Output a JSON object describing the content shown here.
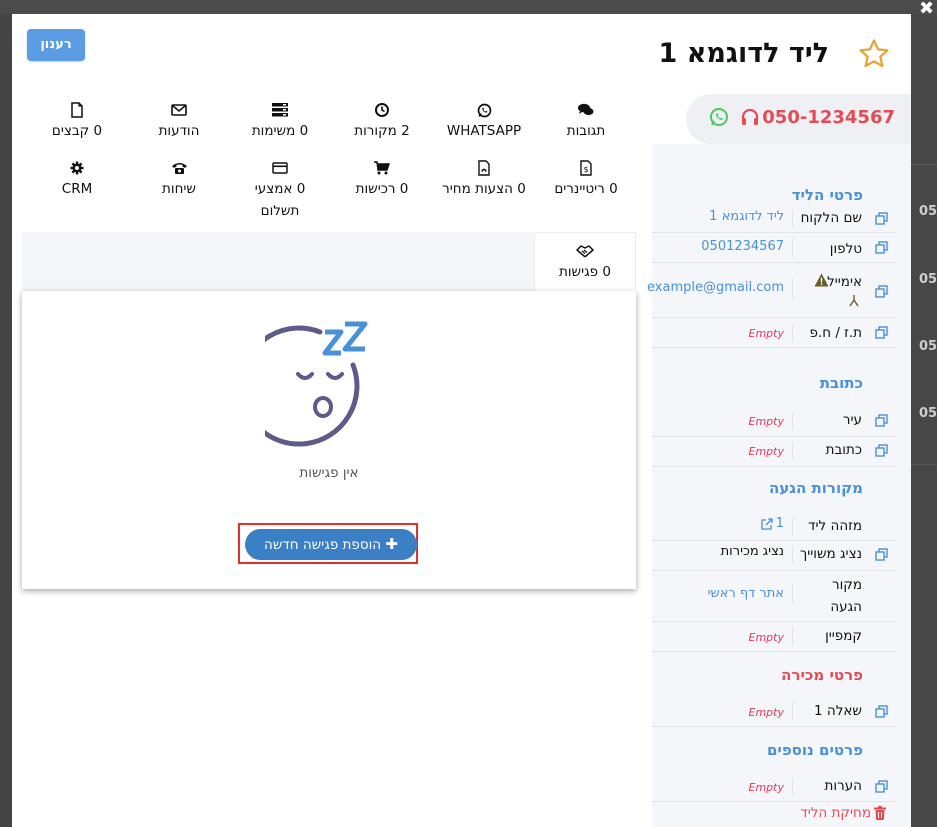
{
  "window": {
    "close_glyph": "✖"
  },
  "header": {
    "title": "ליד לדוגמא 1",
    "refresh_label": "רענון"
  },
  "contact_bar": {
    "phone": "050-1234567"
  },
  "tabs": [
    {
      "label": "תגובות",
      "icon": "comments-icon"
    },
    {
      "label": "WHATSAPP",
      "icon": "whatsapp-icon"
    },
    {
      "label": "2 מקורות",
      "icon": "clock-icon"
    },
    {
      "label": "0 משימות",
      "icon": "tasks-icon"
    },
    {
      "label": "הודעות",
      "icon": "envelope-icon"
    },
    {
      "label": "0 קבצים",
      "icon": "file-icon"
    },
    {
      "label": "0 ריטיינרים",
      "icon": "invoice-icon"
    },
    {
      "label": "0 הצעות מחיר",
      "icon": "pdf-icon"
    },
    {
      "label": "0 רכישות",
      "icon": "cart-icon"
    },
    {
      "label": "0 אמצעי תשלום",
      "icon": "credit-card-icon"
    },
    {
      "label": "שיחות",
      "icon": "phone-icon"
    },
    {
      "label": "CRM",
      "icon": "gear-icon"
    },
    {
      "label": "0 פגישות",
      "icon": "handshake-icon"
    }
  ],
  "meetings_panel": {
    "empty_text": "אין פגישות",
    "add_button_label": "הוספת פגישה חדשה"
  },
  "sidebar": {
    "lead_details_title": "פרטי הליד",
    "lead_details": [
      {
        "label": "שם הלקוח",
        "value": "ליד לדוגמא 1"
      },
      {
        "label": "טלפון",
        "value": "0501234567"
      },
      {
        "label": "אימייל",
        "value": "example@gmail.com"
      },
      {
        "label": "ת.ז / ח.פ",
        "value": "Empty"
      }
    ],
    "address_title": "כתובת",
    "address": [
      {
        "label": "עיר",
        "value": "Empty"
      },
      {
        "label": "כתובת",
        "value": "Empty"
      }
    ],
    "sources_title": "מקורות הגעה",
    "sources": [
      {
        "label": "מזהה ליד",
        "value": "1"
      },
      {
        "label": "נציג משוייך",
        "value": "נציג מכירות"
      },
      {
        "label": "מקור הגעה",
        "value": "אתר דף ראשי"
      },
      {
        "label": "קמפיין",
        "value": "Empty"
      }
    ],
    "sales_title": "פרטי מכירה",
    "sales": [
      {
        "label": "שאלה 1",
        "value": "Empty"
      }
    ],
    "extra_title": "פרטים נוספים",
    "extra": [
      {
        "label": "הערות",
        "value": "Empty"
      }
    ],
    "delete_label": "מחיקת הליד"
  },
  "background": {
    "right_numbers": [
      "05",
      "05",
      "05",
      "05"
    ]
  },
  "colors": {
    "accent": "#4a90d9",
    "danger": "#e54b55",
    "button": "#3b7fc4",
    "refresh": "#5a9de3",
    "whatsapp": "#4cc764",
    "star": "#e8a23a"
  }
}
